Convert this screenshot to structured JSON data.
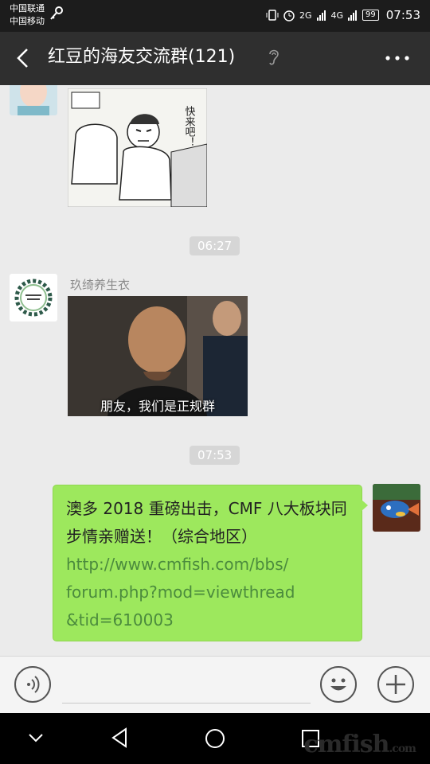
{
  "status_bar": {
    "carrier_1": "中国联通",
    "carrier_2": "中国移动",
    "signal_1": "2G",
    "signal_2": "4G",
    "battery": "99",
    "time": "07:53"
  },
  "header": {
    "title": "红豆的海友交流群(121)"
  },
  "messages": {
    "timestamp_1": "06:27",
    "sender_name": "玖绮养生衣",
    "image_caption": "朋友，我们是正规群",
    "sticker_text": "快来吧！",
    "timestamp_2": "07:53",
    "outgoing_text": "澳多 2018 重磅出击，CMF 八大板块同步情亲赠送！（综合地区）",
    "outgoing_link": "http://www.cmfish.com/bbs/forum.php?mod=viewthread&tid=610003",
    "link_line_1": "http://www.cmfish.com/bbs/",
    "link_line_2": "forum.php?mod=viewthread",
    "link_line_3": "&tid=610003"
  },
  "watermark": {
    "main": "cmfish",
    "suffix": ".com"
  },
  "colors": {
    "bubble": "#9de85d",
    "link": "#4b8b3d",
    "title_bar": "#2f2f2f"
  }
}
